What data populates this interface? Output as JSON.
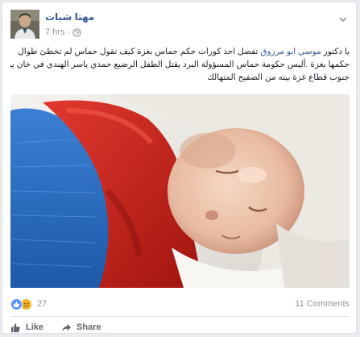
{
  "post": {
    "author": "مهنا شبات",
    "timestamp": "7 hrs",
    "separator": "·",
    "privacy_icon": "globe-icon",
    "menu_icon": "chevron-down-icon",
    "text_line_1_pre": "يا دكتور ",
    "mention": "موسى ابو مرزوق",
    "text_line_1_post": " تفضل احد كورات حكم حماس بغزة كيف تقول حماس لم تخطئ طوال",
    "text_line_2": "حكمها بغزة .أليس حكومة حماس المسؤولة البرد يقتل الطفل الرضيع حمدي ياسر الهندي في خان يونس",
    "text_line_3": "جنوب قطاع غزة بيته من الصفيح المتهالك"
  },
  "stats": {
    "reaction_icons": [
      "like-icon",
      "sad-icon"
    ],
    "reactions_count": "27",
    "comments": "11 Comments"
  },
  "actions": {
    "like_label": "Like",
    "share_label": "Share"
  },
  "colors": {
    "link": "#365899",
    "meta": "#90949c",
    "like_blue": "#5890ff",
    "sad_yellow": "#f7b125"
  }
}
